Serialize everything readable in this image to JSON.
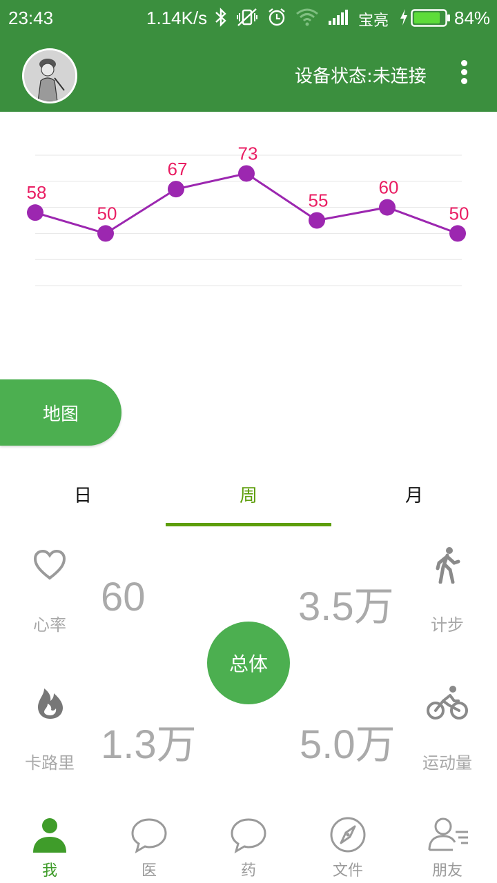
{
  "status_bar": {
    "time": "23:43",
    "net_speed": "1.14K/s",
    "carrier": "宝亮",
    "battery_percent": "84%",
    "battery_level": 0.84,
    "icons": [
      "bluetooth-icon",
      "mute-vibrate-icon",
      "alarm-icon",
      "wifi-icon",
      "signal-icon",
      "charging-icon",
      "battery-icon"
    ]
  },
  "app_bar": {
    "device_status": "设备状态:未连接",
    "icons": [
      "avatar",
      "more-vert-icon"
    ]
  },
  "chart_data": {
    "type": "line",
    "x": [
      1,
      2,
      3,
      4,
      5,
      6,
      7
    ],
    "series": [
      {
        "values": [
          58,
          50,
          67,
          73,
          55,
          60,
          50
        ]
      }
    ],
    "data_labels": [
      "58",
      "50",
      "67",
      "73",
      "55",
      "60",
      "50"
    ],
    "ylim": [
      30,
      80
    ],
    "grid": true,
    "colors": {
      "line": "#9c27b0",
      "label": "#e91e63",
      "grid": "#e6e6e6"
    }
  },
  "map_button": {
    "label": "地图"
  },
  "tabs": [
    {
      "label": "日",
      "active": false
    },
    {
      "label": "周",
      "active": true
    },
    {
      "label": "月",
      "active": false
    }
  ],
  "metrics": {
    "heart_rate": {
      "label": "心率",
      "value": "60",
      "icon": "heart-icon"
    },
    "steps": {
      "label": "计步",
      "value": "3.5万",
      "icon": "walking-icon"
    },
    "calories": {
      "label": "卡路里",
      "value": "1.3万",
      "icon": "flame-icon"
    },
    "exercise": {
      "label": "运动量",
      "value": "5.0万",
      "icon": "cycling-icon"
    }
  },
  "total_button": {
    "label": "总体"
  },
  "bottom_nav": [
    {
      "label": "我",
      "icon": "person-icon",
      "active": true
    },
    {
      "label": "医",
      "icon": "chat-bubble-icon",
      "active": false
    },
    {
      "label": "药",
      "icon": "chat-bubble-icon",
      "active": false
    },
    {
      "label": "文件",
      "icon": "compass-icon",
      "active": false
    },
    {
      "label": "朋友",
      "icon": "contacts-icon",
      "active": false
    }
  ],
  "colors": {
    "primary": "#3b8f3e",
    "accent": "#4caf50",
    "tab_active": "#5d9e0b",
    "nav_active": "#3f9c2a",
    "metric_gray": "#aaaaaa"
  }
}
